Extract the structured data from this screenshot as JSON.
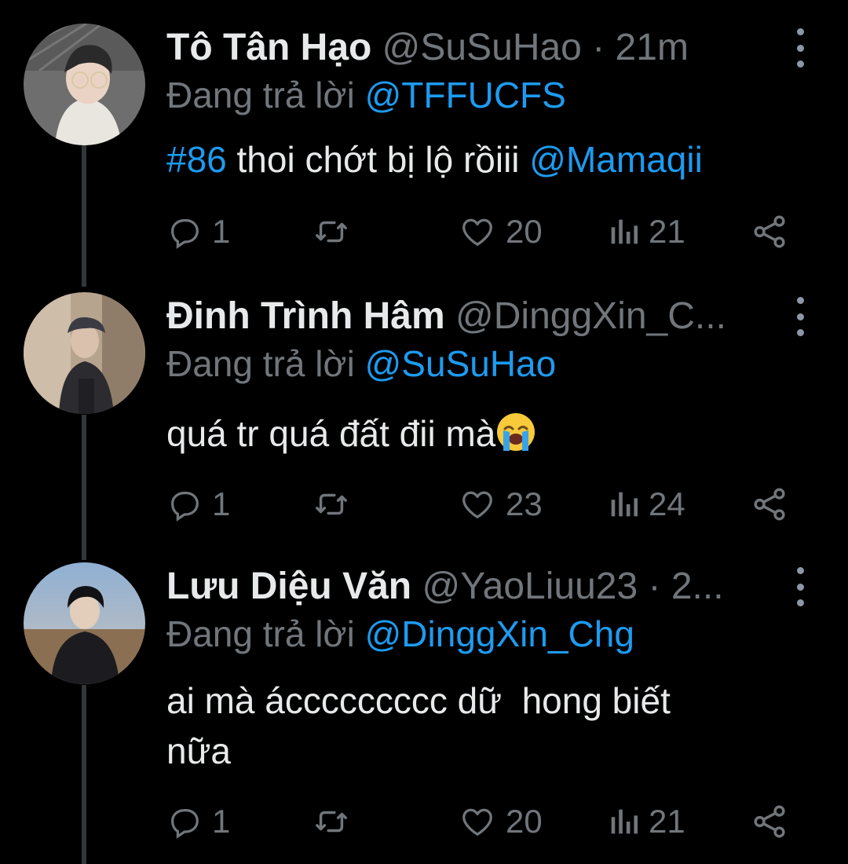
{
  "tweets": [
    {
      "name": "Tô Tân Hạo",
      "handle": "@SuSuHao",
      "dot": "·",
      "time": "21m",
      "reply_prefix": "Đang trả lời",
      "reply_to": "@TFFUCFS",
      "body": {
        "hashtag": "#86",
        "text": " thoi chớt bị lộ rồiii ",
        "mention": "@Mamaqii"
      },
      "replies": "1",
      "likes": "20",
      "views": "21"
    },
    {
      "name": "Đinh Trình Hâm",
      "handle": "@DinggXin_C...",
      "reply_prefix": "Đang trả lời",
      "reply_to": "@SuSuHao",
      "body": {
        "text": "quá tr quá đất đii mà"
      },
      "replies": "1",
      "likes": "23",
      "views": "24"
    },
    {
      "name": "Lưu Diệu Văn",
      "handle": "@YaoLiuu23",
      "dot": "·",
      "time": "2...",
      "reply_prefix": "Đang trả lời",
      "reply_to": "@DinggXin_Chg",
      "body": {
        "line1": "ai mà áccccccccc dữ  hong biết",
        "line2": "nữa"
      },
      "replies": "1",
      "likes": "20",
      "views": "21"
    }
  ],
  "icons": {
    "reply": "reply-icon",
    "retweet": "retweet-icon",
    "like": "heart-icon",
    "views": "views-icon",
    "share": "share-icon",
    "more": "more-vertical-icon",
    "emoji": "loudly-crying-face-emoji"
  },
  "colors": {
    "background": "#000000",
    "text": "#e7e9ea",
    "muted": "#71767b",
    "accent": "#1d9bf0"
  }
}
